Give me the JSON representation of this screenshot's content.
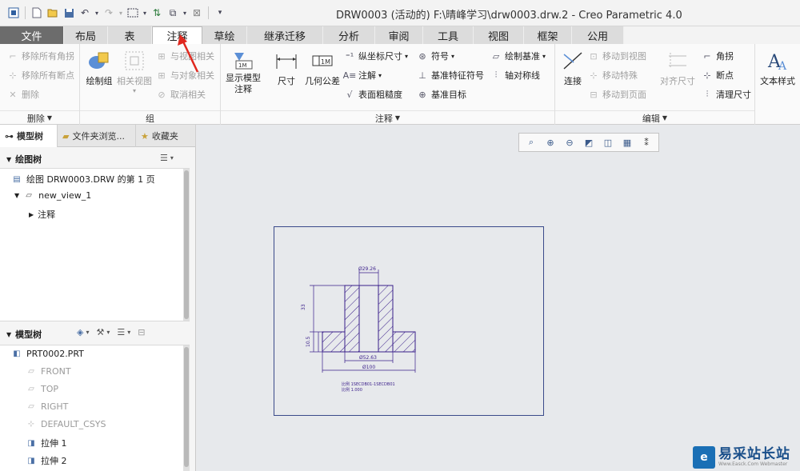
{
  "title": "DRW0003 (活动的) F:\\晴峰学习\\drw0003.drw.2 - Creo Parametric 4.0",
  "quick_access": [
    "new-icon",
    "open-icon",
    "save-icon",
    "undo-icon",
    "redo-icon",
    "select-box-icon",
    "regenerate-icon",
    "windows-icon",
    "close-window-icon",
    "customize-icon"
  ],
  "tabs": [
    {
      "label": "文件",
      "w": 80
    },
    {
      "label": "布局",
      "w": 55
    },
    {
      "label": "表",
      "w": 55
    },
    {
      "label": "注释",
      "w": 63
    },
    {
      "label": "草绘",
      "w": 56
    },
    {
      "label": "继承迁移",
      "w": 95
    },
    {
      "label": "分析",
      "w": 65
    },
    {
      "label": "审阅",
      "w": 60
    },
    {
      "label": "工具",
      "w": 63
    },
    {
      "label": "视图",
      "w": 63
    },
    {
      "label": "框架",
      "w": 60
    },
    {
      "label": "公用",
      "w": 65
    }
  ],
  "ribbon": {
    "delete_group": {
      "items": [
        "移除所有角拐",
        "移除所有断点",
        "删除"
      ],
      "footer": "删除"
    },
    "group_group": {
      "big": "绘制组",
      "related_view": "相关视图",
      "items": [
        "与视图相关",
        "与对象相关",
        "取消相关"
      ],
      "footer": "组"
    },
    "annotation_group": {
      "show_model": "显示模型\n注释",
      "dimension": "尺寸",
      "geom_tol": "几何公差",
      "coord_dim": "纵坐标尺寸",
      "symbol": "符号",
      "draw_datum": "绘制基准",
      "note": "注解",
      "datum_feature_symbol": "基准特征符号",
      "axis_symmetry": "轴对称线",
      "surface_finish": "表面粗糙度",
      "datum_target": "基准目标",
      "footer": "注释"
    },
    "edit_group": {
      "connect": "连接",
      "items": [
        "移动到视图",
        "移动特殊",
        "移动到页面"
      ],
      "align_dim": "对齐尺寸",
      "jog": "角拐",
      "breakpoint": "断点",
      "cleanup_dim": "清理尺寸",
      "footer": "编辑"
    },
    "text_style": "文本样式"
  },
  "panel": {
    "tabs": [
      "模型树",
      "文件夹浏览...",
      "收藏夹"
    ],
    "drawing_tree": {
      "title": "绘图树",
      "items": [
        "绘图 DRW0003.DRW 的第 1 页",
        "new_view_1",
        "注释"
      ]
    },
    "model_tree": {
      "title": "模型树",
      "items": [
        "PRT0002.PRT",
        "FRONT",
        "TOP",
        "RIGHT",
        "DEFAULT_CSYS",
        "拉伸 1",
        "拉伸 2"
      ]
    }
  },
  "view_toolbar": [
    "refit-icon",
    "zoom-in-icon",
    "zoom-out-icon",
    "repaint-icon",
    "display-style-icon",
    "datum-display-icon",
    "annotation-display-icon"
  ],
  "drawing": {
    "dims": {
      "top": "Ø29.26",
      "left_total": "33",
      "left_base": "10.5",
      "bottom1": "Ø52.63",
      "bottom2": "Ø100",
      "note1": "比例  1SECDB01-1SECDB01",
      "note2": "比例  1.000"
    }
  },
  "watermark": {
    "main": "易采站长站",
    "sub": "Www.Easck.Com Webmaster"
  }
}
